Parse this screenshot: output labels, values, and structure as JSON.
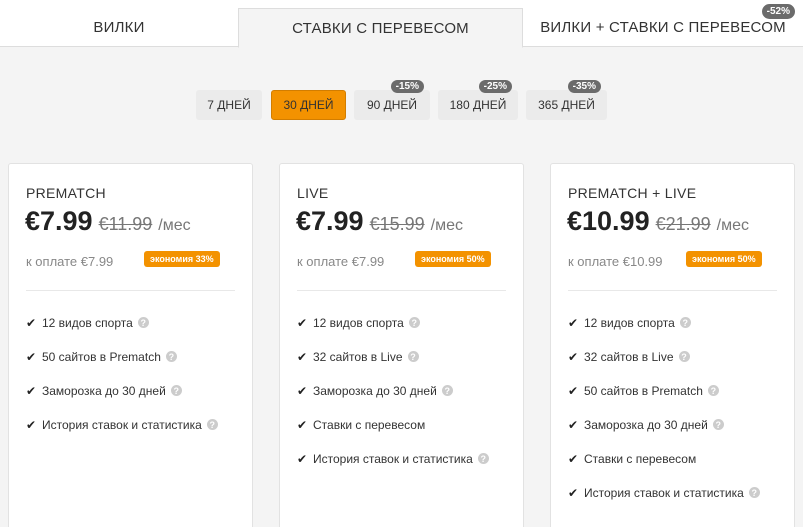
{
  "tabs": [
    {
      "label": "ВИЛКИ"
    },
    {
      "label": "СТАВКИ С ПЕРЕВЕСОМ"
    },
    {
      "label": "ВИЛКИ + СТАВКИ С ПЕРЕВЕСОМ",
      "badge": "-52%"
    }
  ],
  "periods": [
    {
      "label": "7 ДНЕЙ"
    },
    {
      "label": "30 ДНЕЙ"
    },
    {
      "label": "90 ДНЕЙ",
      "badge": "-15%"
    },
    {
      "label": "180 ДНЕЙ",
      "badge": "-25%"
    },
    {
      "label": "365 ДНЕЙ",
      "badge": "-35%"
    }
  ],
  "colors": {
    "accent": "#f39200",
    "badge": "#6b6b6b"
  },
  "plans": [
    {
      "title": "PREMATCH",
      "price": "€7.99",
      "old_price": "€11.99",
      "per": "/мес",
      "pay": "к оплате €7.99",
      "save": "экономия 33%",
      "features": [
        "12 видов спорта",
        "50 сайтов в Prematch",
        "Заморозка до 30 дней",
        "История ставок и статистика"
      ]
    },
    {
      "title": "LIVE",
      "price": "€7.99",
      "old_price": "€15.99",
      "per": "/мес",
      "pay": "к оплате €7.99",
      "save": "экономия 50%",
      "features": [
        "12 видов спорта",
        "32 сайтов в Live",
        "Заморозка до 30 дней",
        "Ставки с перевесом",
        "История ставок и статистика"
      ]
    },
    {
      "title": "PREMATCH + LIVE",
      "price": "€10.99",
      "old_price": "€21.99",
      "per": "/мес",
      "pay": "к оплате €10.99",
      "save": "экономия 50%",
      "features": [
        "12 видов спорта",
        "32 сайтов в Live",
        "50 сайтов в Prematch",
        "Заморозка до 30 дней",
        "Ставки с перевесом",
        "История ставок и статистика"
      ]
    }
  ],
  "help_glyph": "?",
  "check_glyph": "✔"
}
